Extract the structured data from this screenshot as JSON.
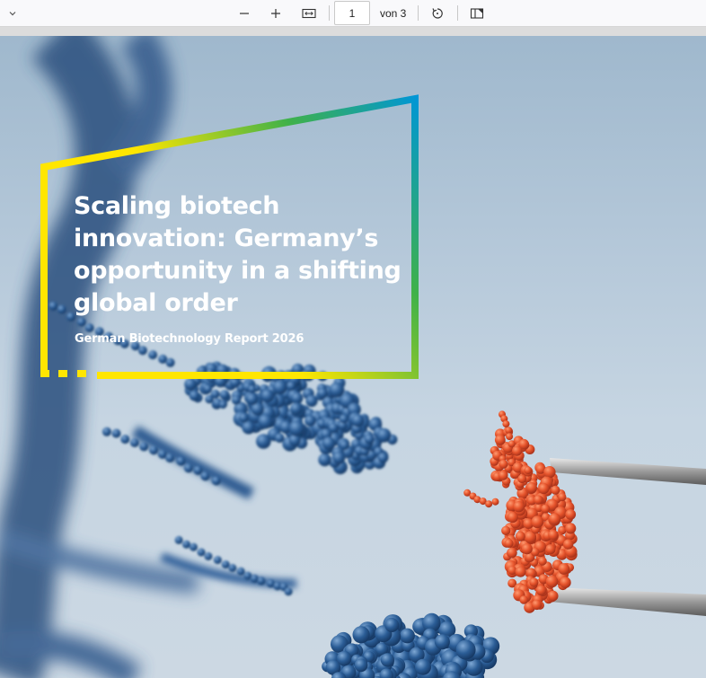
{
  "toolbar": {
    "sidebar_toggle_icon": "chevron-down-icon",
    "zoom_out_icon": "minus-icon",
    "zoom_in_icon": "plus-icon",
    "fit_width_icon": "fit-width-icon",
    "current_page": "1",
    "page_total_label": "von 3",
    "rotate_icon": "rotate-icon",
    "page_view_icon": "page-view-icon"
  },
  "cover": {
    "title": "Scaling biotech innovation: Germany’s opportunity in a shifting global order",
    "subtitle": "German Biotechnology Report 2026",
    "frame_colors": [
      "#ffe600",
      "#ffe600",
      "#3fb14a",
      "#0096d6"
    ],
    "image": "blue DNA molecule strands and red molecule held by tweezers"
  }
}
